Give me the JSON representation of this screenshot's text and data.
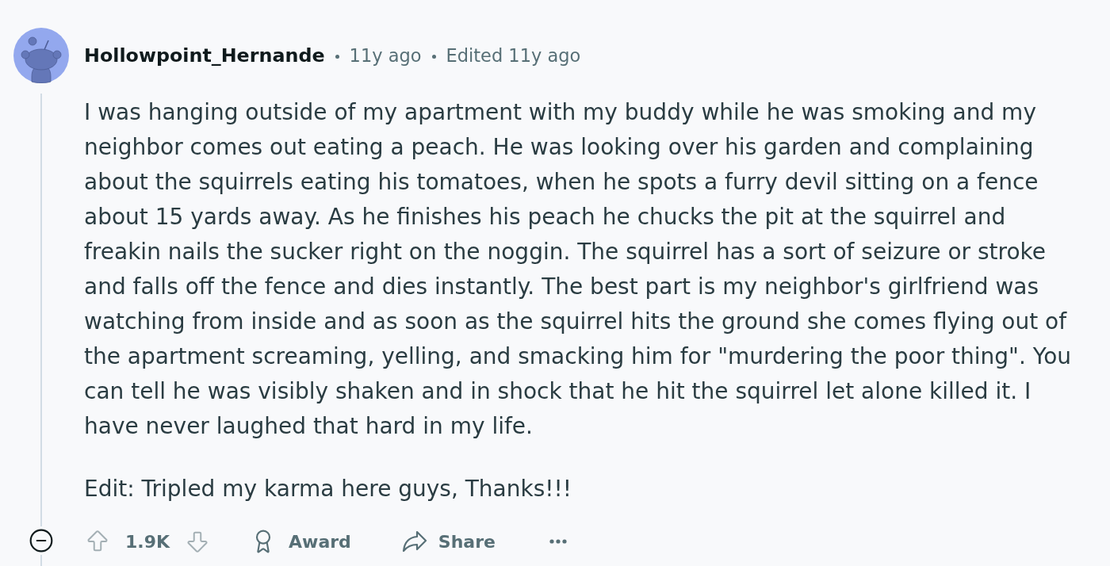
{
  "comment": {
    "author": "Hollowpoint_Hernande",
    "posted": "11y ago",
    "edited": "Edited 11y ago",
    "body": [
      "I was hanging outside of my apartment with my buddy while he was smoking and my neighbor comes out eating a peach. He was looking over his garden and complaining about the squirrels eating his tomatoes, when he spots a furry devil sitting on a fence about 15 yards away. As he finishes his peach he chucks the pit at the squirrel and freakin nails the sucker right on the noggin. The squirrel has a sort of seizure or stroke and falls off the fence and dies instantly. The best part is my neighbor's girlfriend was watching from inside and as soon as the squirrel hits the ground she comes flying out of the apartment screaming, yelling, and smacking him for \"murdering the poor thing\". You can tell he was visibly shaken and in shock that he hit the squirrel let alone killed it. I have never laughed that hard in my life.",
      "Edit: Tripled my karma here guys, Thanks!!!"
    ],
    "actions": {
      "score": "1.9K",
      "award": "Award",
      "share": "Share"
    }
  }
}
